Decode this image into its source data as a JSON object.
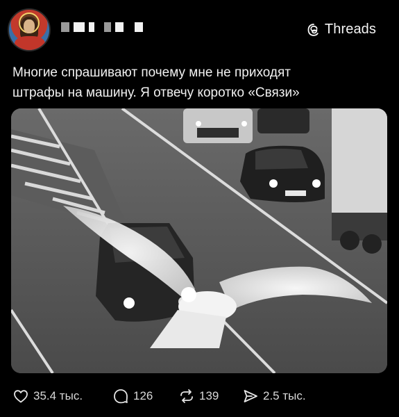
{
  "header": {
    "avatar_icon": "profile-avatar",
    "username_redacted": true,
    "brand_icon": "threads-logo-icon",
    "brand_label": "Threads"
  },
  "post": {
    "text_line1": "Многие спрашивают почему мне не приходят",
    "text_line2": "штрафы на машину. Я отвечу коротко «Связи»",
    "media_description_icon": "photo-highway-seagull"
  },
  "actions": {
    "likes": {
      "icon": "heart-icon",
      "count": "35.4 тыс."
    },
    "replies": {
      "icon": "comment-icon",
      "count": "126"
    },
    "reposts": {
      "icon": "repost-icon",
      "count": "139"
    },
    "shares": {
      "icon": "send-icon",
      "count": "2.5 тыс."
    }
  },
  "colors": {
    "background": "#000000",
    "text": "#f1f1f1",
    "muted": "#d8d8d8"
  }
}
